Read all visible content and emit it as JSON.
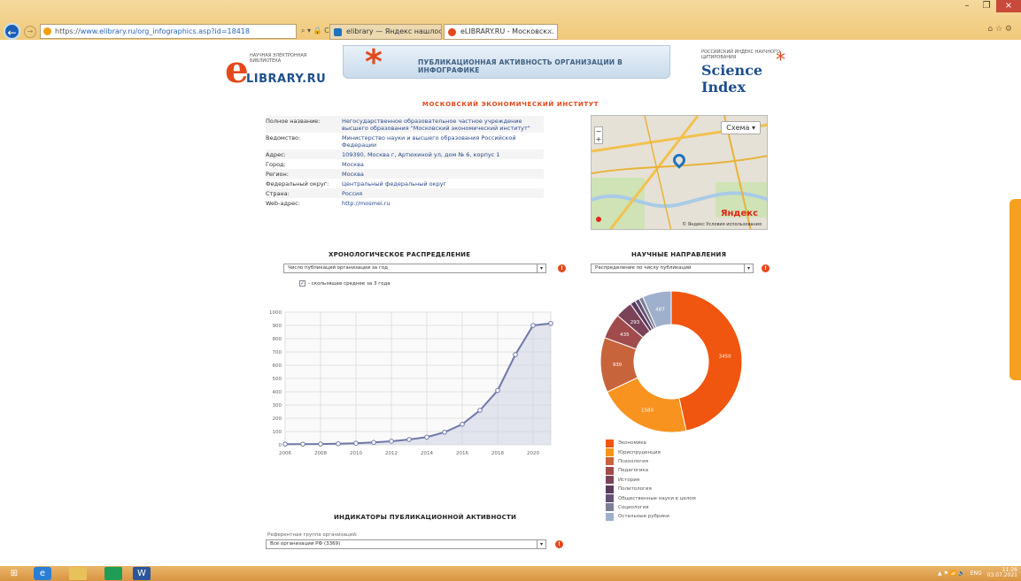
{
  "browser": {
    "url_protocol": "https://",
    "url_rest": "www.elibrary.ru/org_infographics.asp?id=18418",
    "addr_tools": "⌕ ▾ 🔒 C",
    "tabs": [
      "elibrary — Яндекс нашлось 1...",
      "eLIBRARY.RU - Московск..."
    ],
    "tab_close": "×",
    "window_controls": [
      "–",
      "❐",
      "×"
    ],
    "corner_icons": "⌂ ☆ ⚙"
  },
  "header": {
    "logo_small": "НАУЧНАЯ ЭЛЕКТРОННАЯ БИБЛИОТЕКА",
    "logo_letter": "e",
    "logo_name": "LIBRARY.RU",
    "banner_title": "ПУБЛИКАЦИОННАЯ АКТИВНОСТЬ ОРГАНИЗАЦИИ В ИНФОГРАФИКЕ",
    "si_small": "РОССИЙСКИЙ ИНДЕКС НАУЧНОГО ЦИТИРОВАНИЯ",
    "si_name": "Science Index",
    "asterisk": "*"
  },
  "org": {
    "name": "МОСКОВСКИЙ ЭКОНОМИЧЕСКИЙ ИНСТИТУТ",
    "rows": [
      {
        "k": "Полное название:",
        "v": "Негосударственное образовательное частное учреждение высшего образования \"Московский экономический институт\""
      },
      {
        "k": "Ведомство:",
        "v": "Министерство науки и высшего образования Российской Федерации"
      },
      {
        "k": "Адрес:",
        "v": "109390, Москва г, Артюхиной ул, дом № 6, корпус 1"
      },
      {
        "k": "Город:",
        "v": "Москва"
      },
      {
        "k": "Регион:",
        "v": "Москва"
      },
      {
        "k": "Федеральный округ:",
        "v": "Центральный федеральный округ"
      },
      {
        "k": "Страна:",
        "v": "Россия"
      },
      {
        "k": "Web-адрес:",
        "v": "http://mosmei.ru"
      }
    ]
  },
  "map": {
    "schema_label": "Схема ▾",
    "zoom_in": "+",
    "zoom_out": "−",
    "brand": "Яндекс",
    "terms": "© Яндекс  Условия использования",
    "road_color": "#f2c14e",
    "road2_color": "#e8b23a",
    "park_color": "#cfe3b6",
    "water_color": "#a9cbe8",
    "pin_color": "#1e73be"
  },
  "chron": {
    "title": "ХРОНОЛОГИЧЕСКОЕ РАСПРЕДЕЛЕНИЕ",
    "select": "Число публикаций организации за год",
    "checkbox_label": "- скользящее среднее за 3 года",
    "checkmark": "✓",
    "select_arrow": "▾",
    "info": "!"
  },
  "sci": {
    "title": "НАУЧНЫЕ НАПРАВЛЕНИЯ",
    "select": "Распределение по числу публикаций",
    "select_arrow": "▾",
    "info": "!"
  },
  "indicators": {
    "title": "ИНДИКАТОРЫ ПУБЛИКАЦИОННОЙ АКТИВНОСТИ",
    "ref_label": "Референтная группа организаций:",
    "select": "Все организации РФ (3369)",
    "select_arrow": "▾",
    "info": "!"
  },
  "taskbar": {
    "start": "⊞",
    "lang": "ENG",
    "tray_icons": "▲ ⚑ 📶 🔊",
    "time": "11:26",
    "date": "03.07.2021"
  },
  "chart_data": [
    {
      "type": "line",
      "title": "ХРОНОЛОГИЧЕСКОЕ РАСПРЕДЕЛЕНИЕ",
      "x": [
        2006,
        2007,
        2008,
        2009,
        2010,
        2011,
        2012,
        2013,
        2014,
        2015,
        2016,
        2017,
        2018,
        2019,
        2020
      ],
      "values": [
        5,
        5,
        6,
        8,
        12,
        18,
        27,
        40,
        58,
        95,
        155,
        260,
        410,
        680,
        900,
        915
      ],
      "x_points": [
        2006,
        2007,
        2008,
        2009,
        2010,
        2011,
        2012,
        2013,
        2014,
        2015,
        2016,
        2017,
        2018,
        2019,
        2020,
        2021
      ],
      "x_ticks": [
        2006,
        2008,
        2010,
        2012,
        2014,
        2016,
        2018,
        2020
      ],
      "y_ticks": [
        0,
        100,
        200,
        300,
        400,
        500,
        600,
        700,
        800,
        900,
        1000
      ],
      "xlim": [
        2006,
        2021
      ],
      "ylim": [
        0,
        1000
      ],
      "grid": true,
      "line_color": "#6f79a8",
      "fill_color": "#c9cde2",
      "xlabel": "",
      "ylabel": ""
    },
    {
      "type": "pie",
      "title": "НАУЧНЫЕ НАПРАВЛЕНИЯ",
      "donut": true,
      "labels": [
        "Экономика",
        "Юриспруденция",
        "Психология",
        "Педагогика",
        "История",
        "Политология",
        "Общественные науки в целом",
        "Социология",
        "Остальные рубрики"
      ],
      "values": [
        3450,
        1580,
        930,
        430,
        290,
        90,
        75,
        70,
        487
      ],
      "shown_labels": [
        "3450",
        "1580",
        "930",
        "435",
        "293",
        "",
        "",
        "",
        "487"
      ],
      "colors": [
        "#f0560f",
        "#f7931e",
        "#c8643c",
        "#a14c4c",
        "#7a4358",
        "#5c3a5e",
        "#645275",
        "#7e7f96",
        "#9fb0cc"
      ]
    }
  ]
}
